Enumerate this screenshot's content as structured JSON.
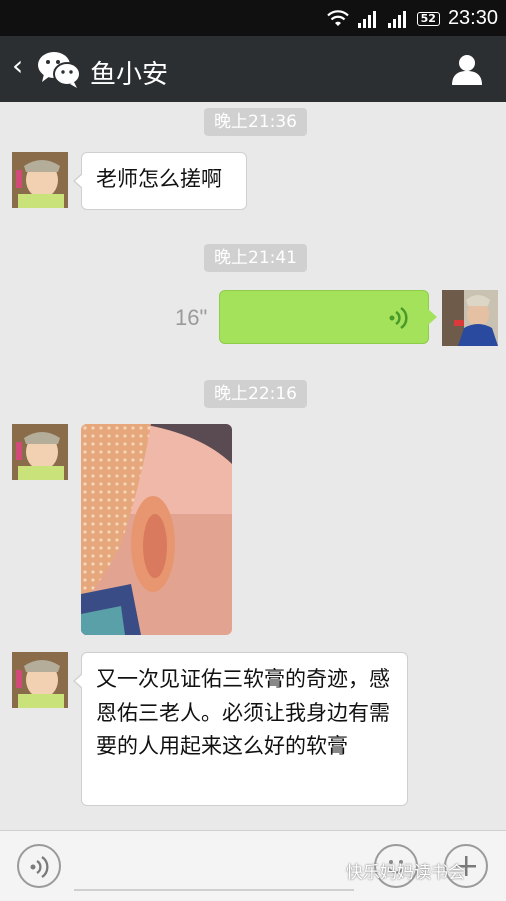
{
  "status_bar": {
    "time": "23:30",
    "battery": "52"
  },
  "header": {
    "back_glyph": "‹",
    "title": "鱼小安"
  },
  "messages": [
    {
      "time_label": "晚上21:36",
      "sender": "鱼小安",
      "text": "老师怎么搓啊"
    },
    {
      "time_label": "晚上21:41",
      "duration": "16\""
    },
    {
      "time_label": "晚上22:16",
      "content": "image"
    },
    {
      "sender": "鱼小安",
      "text": "又一次见证佑三软膏的奇迹，感恩佑三老人。必须让我身边有需要的人用起来这么好的软膏"
    }
  ],
  "watermark": "快乐妈妈读书会",
  "colors": {
    "voice_bubble": "#a3e25a",
    "title_bar": "#2b2f31",
    "chat_bg": "#e9e9e9"
  }
}
